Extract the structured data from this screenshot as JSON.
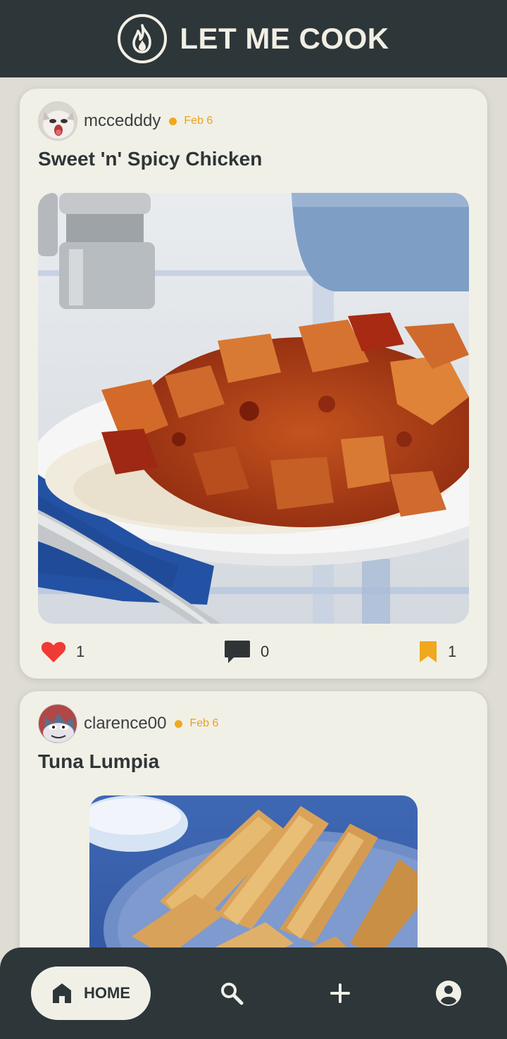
{
  "header": {
    "title": "LET ME COOK",
    "logo_icon": "flame-icon"
  },
  "posts": [
    {
      "username": "mccedddy",
      "date": "Feb 6",
      "title": "Sweet 'n' Spicy Chicken",
      "likes": "1",
      "comments": "0",
      "saves": "1"
    },
    {
      "username": "clarence00",
      "date": "Feb 6",
      "title": "Tuna Lumpia"
    }
  ],
  "nav": {
    "home_label": "HOME",
    "items": [
      "home-icon",
      "search-icon",
      "plus-icon",
      "profile-icon"
    ]
  },
  "colors": {
    "dark": "#2d3639",
    "cream": "#f1f0e7",
    "accent": "#f0a81e",
    "like": "#f03a35"
  }
}
